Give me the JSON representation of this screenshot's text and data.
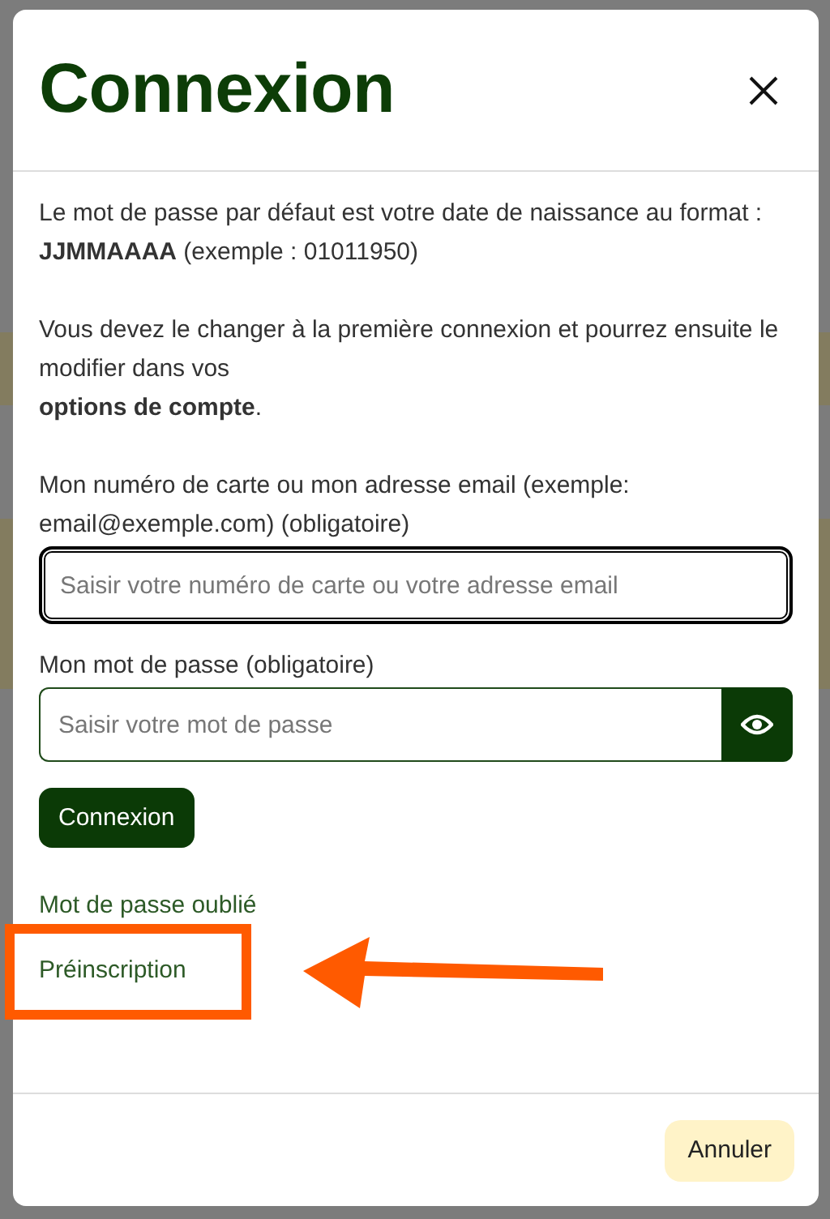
{
  "dialog": {
    "title": "Connexion"
  },
  "paragraphs": [
    {
      "lines": [
        "Le mot de passe par défaut est votre date de naissance au format :",
        "**JJMMAAAA** (exemple : 01011950)"
      ]
    },
    {
      "lines": [
        "Vous devez le changer à la première connexion et pourrez ensuite le modifier dans vos",
        "**options de compte**."
      ]
    }
  ],
  "fields": [
    {
      "kind": "text",
      "label": "Mon numéro de carte ou mon adresse email (exemple: email@exemple.com) (obligatoire)",
      "placeholder": "Saisir votre numéro de carte ou votre adresse email",
      "focused": true
    },
    {
      "kind": "password",
      "label": "Mon mot de passe (obligatoire)",
      "placeholder": "Saisir votre mot de passe",
      "focused": false
    }
  ],
  "submit": {
    "label": "Connexion"
  },
  "links": [
    {
      "label": "Mot de passe oublié",
      "highlighted": false
    },
    {
      "label": "Préinscription",
      "highlighted": true
    }
  ],
  "footer": {
    "cancel": "Annuler"
  }
}
